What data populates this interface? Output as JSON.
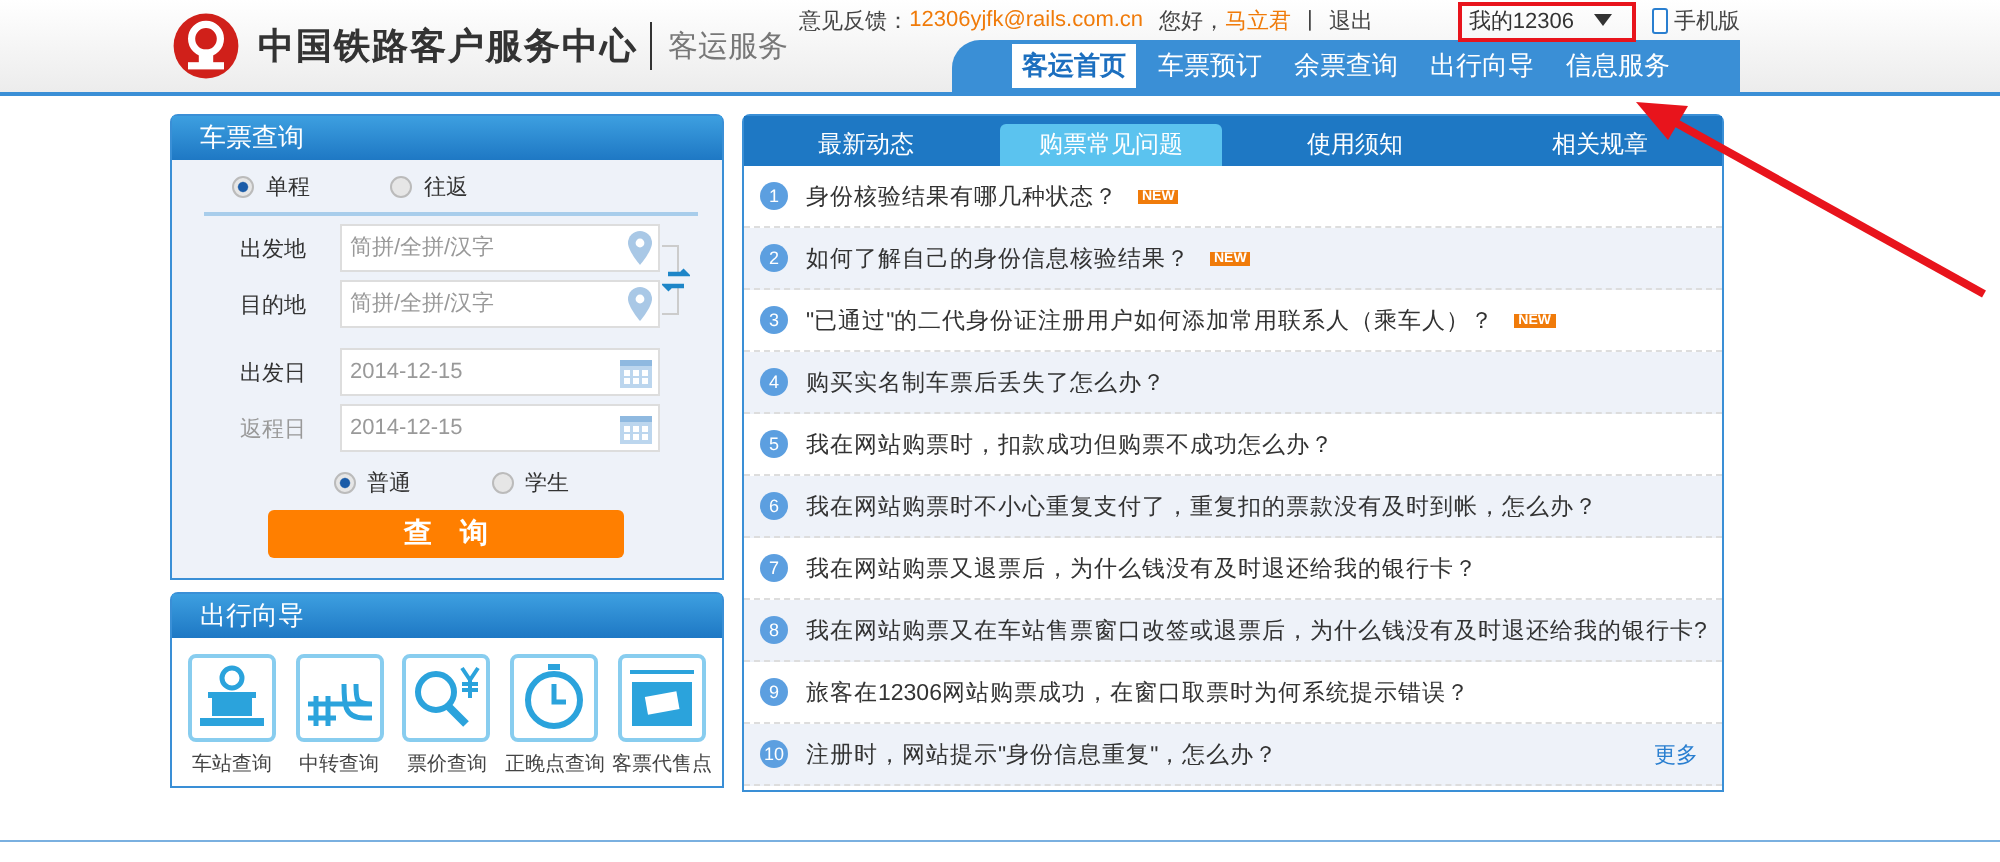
{
  "header": {
    "title": "中国铁路客户服务中心",
    "subtitle": "客运服务",
    "feedback_label": "意见反馈：",
    "feedback_email": "12306yjfk@rails.com.cn",
    "greeting": "您好，",
    "user": "马立君",
    "separator": "|",
    "logout": "退出",
    "my_account": "我的12306",
    "mobile": "手机版",
    "nav": [
      {
        "label": "客运首页",
        "selected": true
      },
      {
        "label": "车票预订",
        "selected": false
      },
      {
        "label": "余票查询",
        "selected": false
      },
      {
        "label": "出行向导",
        "selected": false
      },
      {
        "label": "信息服务",
        "selected": false
      }
    ]
  },
  "ticket_search": {
    "title": "车票查询",
    "trip_types": [
      {
        "label": "单程",
        "selected": true
      },
      {
        "label": "往返",
        "selected": false
      }
    ],
    "from": {
      "label": "出发地",
      "placeholder": "简拼/全拼/汉字"
    },
    "to": {
      "label": "目的地",
      "placeholder": "简拼/全拼/汉字"
    },
    "depart_date": {
      "label": "出发日",
      "value": "2014-12-15",
      "disabled": false
    },
    "return_date": {
      "label": "返程日",
      "value": "2014-12-15",
      "disabled": true
    },
    "passenger_types": [
      {
        "label": "普通",
        "selected": true
      },
      {
        "label": "学生",
        "selected": false
      }
    ],
    "search_button": "查　询"
  },
  "travel_guide": {
    "title": "出行向导",
    "items": [
      {
        "kind": "station",
        "label": "车站查询"
      },
      {
        "kind": "transfer",
        "label": "中转查询"
      },
      {
        "kind": "price",
        "label": "票价查询"
      },
      {
        "kind": "clock",
        "label": "正晚点查询"
      },
      {
        "kind": "agency",
        "label": "客票代售点"
      }
    ]
  },
  "faq": {
    "tabs": [
      {
        "label": "最新动态",
        "selected": false
      },
      {
        "label": "购票常见问题",
        "selected": true
      },
      {
        "label": "使用须知",
        "selected": false
      },
      {
        "label": "相关规章",
        "selected": false
      }
    ],
    "items": [
      {
        "number": "1",
        "text": "身份核验结果有哪几种状态？",
        "badge": "NEW"
      },
      {
        "number": "2",
        "text": "如何了解自己的身份信息核验结果？",
        "badge": "NEW"
      },
      {
        "number": "3",
        "text": "\"已通过\"的二代身份证注册用户如何添加常用联系人（乘车人）？",
        "badge": "NEW"
      },
      {
        "number": "4",
        "text": "购买实名制车票后丢失了怎么办？"
      },
      {
        "number": "5",
        "text": "我在网站购票时，扣款成功但购票不成功怎么办？"
      },
      {
        "number": "6",
        "text": "我在网站购票时不小心重复支付了，重复扣的票款没有及时到帐，怎么办？"
      },
      {
        "number": "7",
        "text": "我在网站购票又退票后，为什么钱没有及时退还给我的银行卡？"
      },
      {
        "number": "8",
        "text": "我在网站购票又在车站售票窗口改签或退票后，为什么钱没有及时退还给我的银行卡?"
      },
      {
        "number": "9",
        "text": "旅客在12306网站购票成功，在窗口取票时为何系统提示错误？"
      },
      {
        "number": "10",
        "text": "注册时，网站提示\"身份信息重复\"，怎么办？"
      }
    ],
    "more": "更多"
  }
}
